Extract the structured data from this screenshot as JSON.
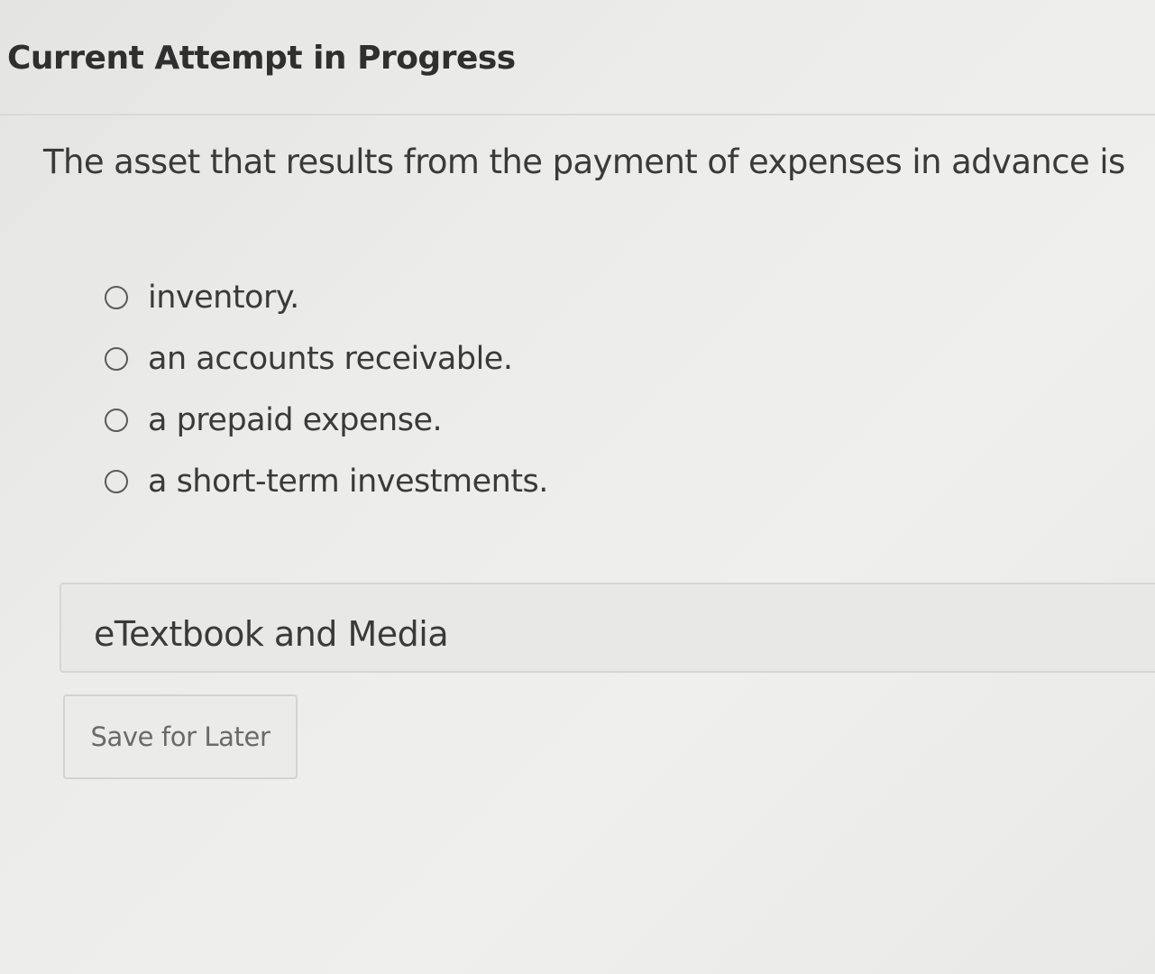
{
  "header": {
    "title": "Current Attempt in Progress"
  },
  "question": {
    "text": "The asset that results from the payment of expenses in advance is",
    "choices": [
      {
        "label": "inventory.",
        "selected": false
      },
      {
        "label": "an accounts receivable.",
        "selected": false
      },
      {
        "label": "a prepaid expense.",
        "selected": false
      },
      {
        "label": "a short-term investments.",
        "selected": false
      }
    ]
  },
  "resources": {
    "etextbook_label": "eTextbook and Media"
  },
  "actions": {
    "save_label": "Save for Later"
  }
}
